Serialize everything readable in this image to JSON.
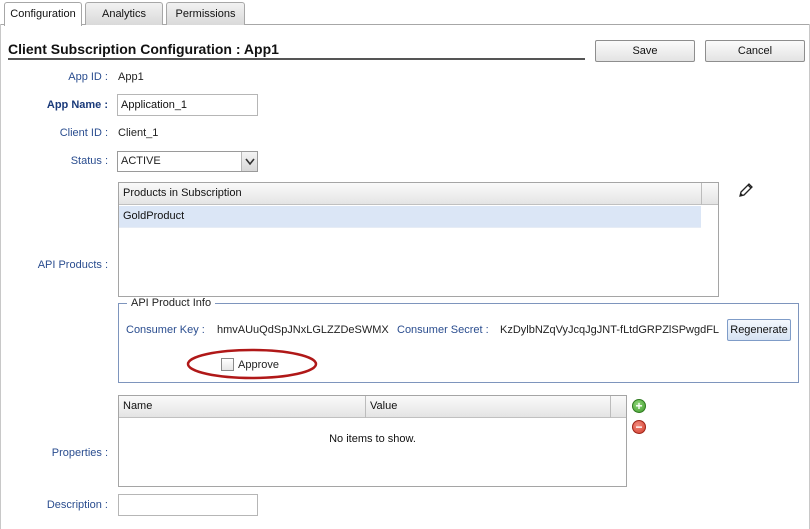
{
  "tabs": [
    {
      "label": "Configuration"
    },
    {
      "label": "Analytics"
    },
    {
      "label": "Permissions"
    }
  ],
  "header": {
    "title": "Client Subscription Configuration : App1",
    "save_label": "Save",
    "cancel_label": "Cancel"
  },
  "form": {
    "app_id_label": "App ID :",
    "app_id": "App1",
    "app_name_label": "App Name :",
    "app_name_value": "Application_1",
    "client_id_label": "Client ID :",
    "client_id": "Client_1",
    "status_label": "Status :",
    "status_value": "ACTIVE",
    "api_products_label": "API Products :",
    "properties_label": "Properties :",
    "description_label": "Description :",
    "description_value": ""
  },
  "products_grid": {
    "header": "Products in Subscription",
    "rows": [
      "GoldProduct"
    ]
  },
  "product_info": {
    "legend": "API Product Info",
    "consumer_key_label": "Consumer Key :",
    "consumer_key": "hmvAUuQdSpJNxLGLZZDeSWMX",
    "consumer_secret_label": "Consumer Secret :",
    "consumer_secret": "KzDylbNZqVyJcqJgJNT-fLtdGRPZlSPwgdFL",
    "regenerate_label": "Regenerate",
    "approve_label": "Approve",
    "approve_checked": false
  },
  "properties_grid": {
    "columns": [
      "Name",
      "Value"
    ],
    "empty_text": "No items to show."
  },
  "icons": {
    "edit": "pencil-icon",
    "add": "add-icon",
    "remove": "remove-icon",
    "dropdown": "chevron-down-icon"
  },
  "colors": {
    "label_blue": "#2a4d8f",
    "selected_row": "#dbe6f6",
    "highlight_ellipse": "#b01818",
    "add_green": "#3f9d2b",
    "remove_red": "#d23b2b"
  }
}
